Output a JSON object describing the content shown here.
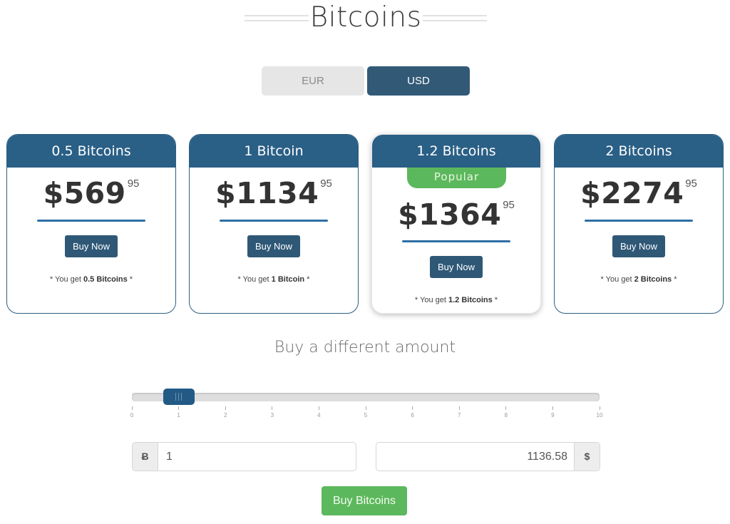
{
  "page": {
    "title": "Bitcoins",
    "subtitle": "Buy a different amount"
  },
  "currency_toggle": {
    "options": [
      {
        "label": "EUR",
        "selected": false
      },
      {
        "label": "USD",
        "selected": true
      }
    ]
  },
  "plans": [
    {
      "title": "0.5 Bitcoins",
      "price_main": "$569",
      "price_cents": "95",
      "button": "Buy Now",
      "note_prefix": "* You get ",
      "note_amount": "0.5 Bitcoins",
      "note_suffix": " *",
      "popular": false
    },
    {
      "title": "1 Bitcoin",
      "price_main": "$1134",
      "price_cents": "95",
      "button": "Buy Now",
      "note_prefix": "* You get ",
      "note_amount": "1 Bitcoin",
      "note_suffix": " *",
      "popular": false
    },
    {
      "title": "1.2 Bitcoins",
      "price_main": "$1364",
      "price_cents": "95",
      "button": "Buy Now",
      "note_prefix": "* You get ",
      "note_amount": "1.2 Bitcoins",
      "note_suffix": " *",
      "popular": true,
      "badge": "Popular"
    },
    {
      "title": "2 Bitcoins",
      "price_main": "$2274",
      "price_cents": "95",
      "button": "Buy Now",
      "note_prefix": "* You get ",
      "note_amount": "2 Bitcoins",
      "note_suffix": " *",
      "popular": false
    }
  ],
  "slider": {
    "min": 0,
    "max": 10,
    "value": 1,
    "ticks": [
      "0",
      "1",
      "2",
      "3",
      "4",
      "5",
      "6",
      "7",
      "8",
      "9",
      "10"
    ]
  },
  "converter": {
    "btc_symbol": "Ƀ",
    "btc_value": "1",
    "usd_symbol": "$",
    "usd_value": "1136.58"
  },
  "buy_button": "Buy Bitcoins",
  "colors": {
    "primary": "#2a5f86",
    "success": "#5cb85c",
    "inactive": "#e6e6e6"
  }
}
